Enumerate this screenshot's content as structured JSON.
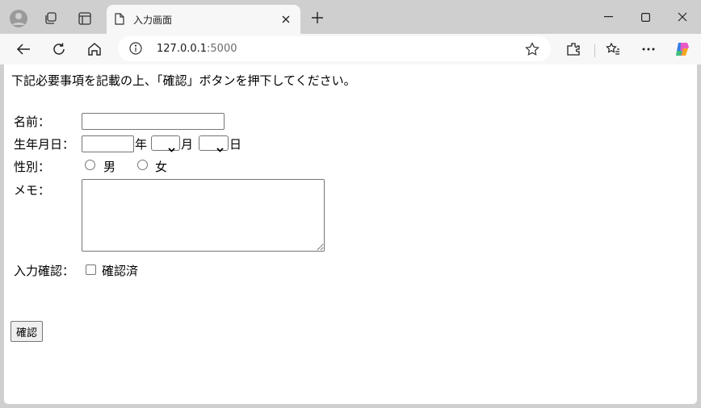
{
  "browser": {
    "tab_title": "入力画面",
    "address": {
      "host": "127.0.0.1",
      "port": ":5000"
    }
  },
  "form": {
    "instruction": "下記必要事項を記載の上、「確認」ボタンを押下してください。",
    "name_label": "名前：",
    "name_value": "",
    "birth_label": "生年月日：",
    "year_value": "",
    "year_unit": "年",
    "month_unit": "月",
    "day_unit": "日",
    "gender_label": "性別：",
    "gender_male": "男",
    "gender_female": "女",
    "memo_label": "メモ：",
    "memo_value": "",
    "confirm_input_label": "入力確認：",
    "confirm_checkbox_label": "確認済",
    "submit_label": "確認"
  }
}
